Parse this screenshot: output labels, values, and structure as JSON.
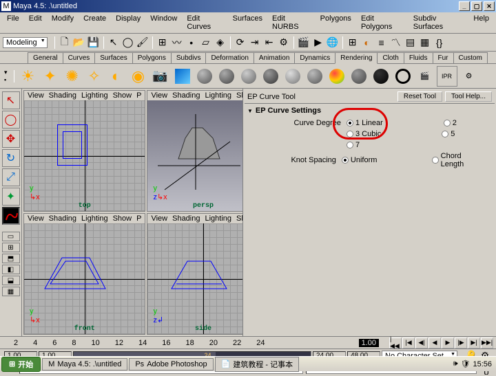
{
  "title": "Maya 4.5: .\\untitled",
  "menu": [
    "File",
    "Edit",
    "Modify",
    "Create",
    "Display",
    "Window",
    "Edit Curves",
    "Surfaces",
    "Edit NURBS",
    "Polygons",
    "Edit Polygons",
    "Subdiv Surfaces",
    "Help"
  ],
  "mode_dropdown": "Modeling",
  "tabs": [
    "General",
    "Curves",
    "Surfaces",
    "Polygons",
    "Subdivs",
    "Deformation",
    "Animation",
    "Dynamics",
    "Rendering",
    "Cloth",
    "Fluids",
    "Fur",
    "Custom"
  ],
  "active_tab": "Rendering",
  "viewport_menu": [
    "View",
    "Shading",
    "Lighting",
    "Show",
    "P"
  ],
  "viewport_labels": {
    "tl": "top",
    "tr": "persp",
    "bl": "front",
    "br": "side"
  },
  "sidepanel": {
    "title": "EP Curve Tool",
    "reset": "Reset Tool",
    "help": "Tool Help...",
    "section": "EP Curve Settings",
    "curve_degree_label": "Curve Degree",
    "knot_spacing_label": "Knot Spacing",
    "degree_opts": {
      "linear": "1 Linear",
      "cubic": "3 Cubic",
      "seven": "7",
      "two": "2",
      "five": "5"
    },
    "knot_opts": {
      "uniform": "Uniform",
      "chord": "Chord Length"
    }
  },
  "timeline": {
    "ticks": [
      "2",
      "4",
      "6",
      "8",
      "10",
      "12",
      "14",
      "16",
      "18",
      "20",
      "22",
      "24"
    ],
    "current": "1.00"
  },
  "range": {
    "start": "1.00",
    "startB": "1.00",
    "mid": "24",
    "end": "24.00",
    "endB": "48.00",
    "charset": "No Character Set"
  },
  "taskbar": {
    "start": "开始",
    "items": [
      "Maya 4.5: .\\untitled",
      "Adobe Photoshop",
      "建筑教程 - 记事本"
    ],
    "clock": "15:56"
  }
}
